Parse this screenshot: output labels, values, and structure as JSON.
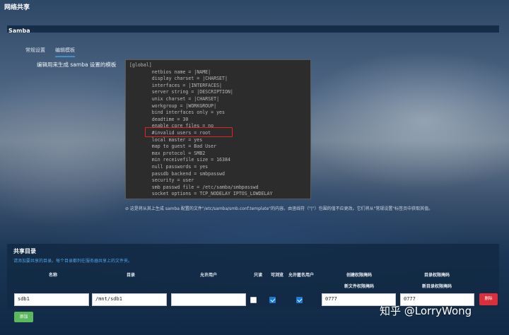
{
  "page": {
    "title": "网络共享"
  },
  "samba": {
    "title": "Samba",
    "tabs": [
      {
        "label": "常规设置",
        "active": false
      },
      {
        "label": "编辑模板",
        "active": true
      }
    ],
    "template_label": "编辑用来生成 samba 设置的模板",
    "template_lines": [
      "[global]",
      "        netbios name = |NAME|",
      "        display charset = |CHARSET|",
      "        interfaces = |INTERFACES|",
      "        server string = |DESCRIPTION|",
      "        unix charset = |CHARSET|",
      "        workgroup = |WORKGROUP|",
      "        bind interfaces only = yes",
      "        deadtime = 30",
      "        enable core files = no",
      "        #invalid users = root",
      "        local master = yes",
      "        map to guest = Bad User",
      "        max protocol = SMB2",
      "        min receivefile size = 16384",
      "        null passwords = yes",
      "        passdb backend = smbpasswd",
      "        security = user",
      "        smb passwd file = /etc/samba/smbpasswd",
      "        socket options = TCP_NODELAY IPTOS_LOWDELAY"
    ],
    "help_text": "⊘ 这是将从其上生成 samba 配置的文件\"/etc/samba/smb.conf.template\"的内容。由竖线符（\"|\"）包围的值不应更改。它们将从\"常规设置\"标签页中获取其值。"
  },
  "shares": {
    "title": "共享目录",
    "description": "请添加要共享的目录。每个目录都列在服务器共享上的文件夹。",
    "columns": {
      "name": "名称",
      "path": "目录",
      "users": "允许用户",
      "read_only": "只读",
      "browseable": "可浏览",
      "guest": "允许匿名用户",
      "create_mask_title": "创建权限掩码",
      "create_mask_sub": "新文件权限掩码",
      "dir_mask_title": "目录权限掩码",
      "dir_mask_sub": "新目录权限掩码"
    },
    "rows": [
      {
        "name": "sdb1",
        "path": "/mnt/sdb1",
        "users": "",
        "read_only": false,
        "browseable": true,
        "guest": true,
        "create_mask": "0777",
        "dir_mask": "0777",
        "delete_label": "删除"
      }
    ],
    "add_label": "添加"
  },
  "watermark": "知乎 @LorryWong"
}
